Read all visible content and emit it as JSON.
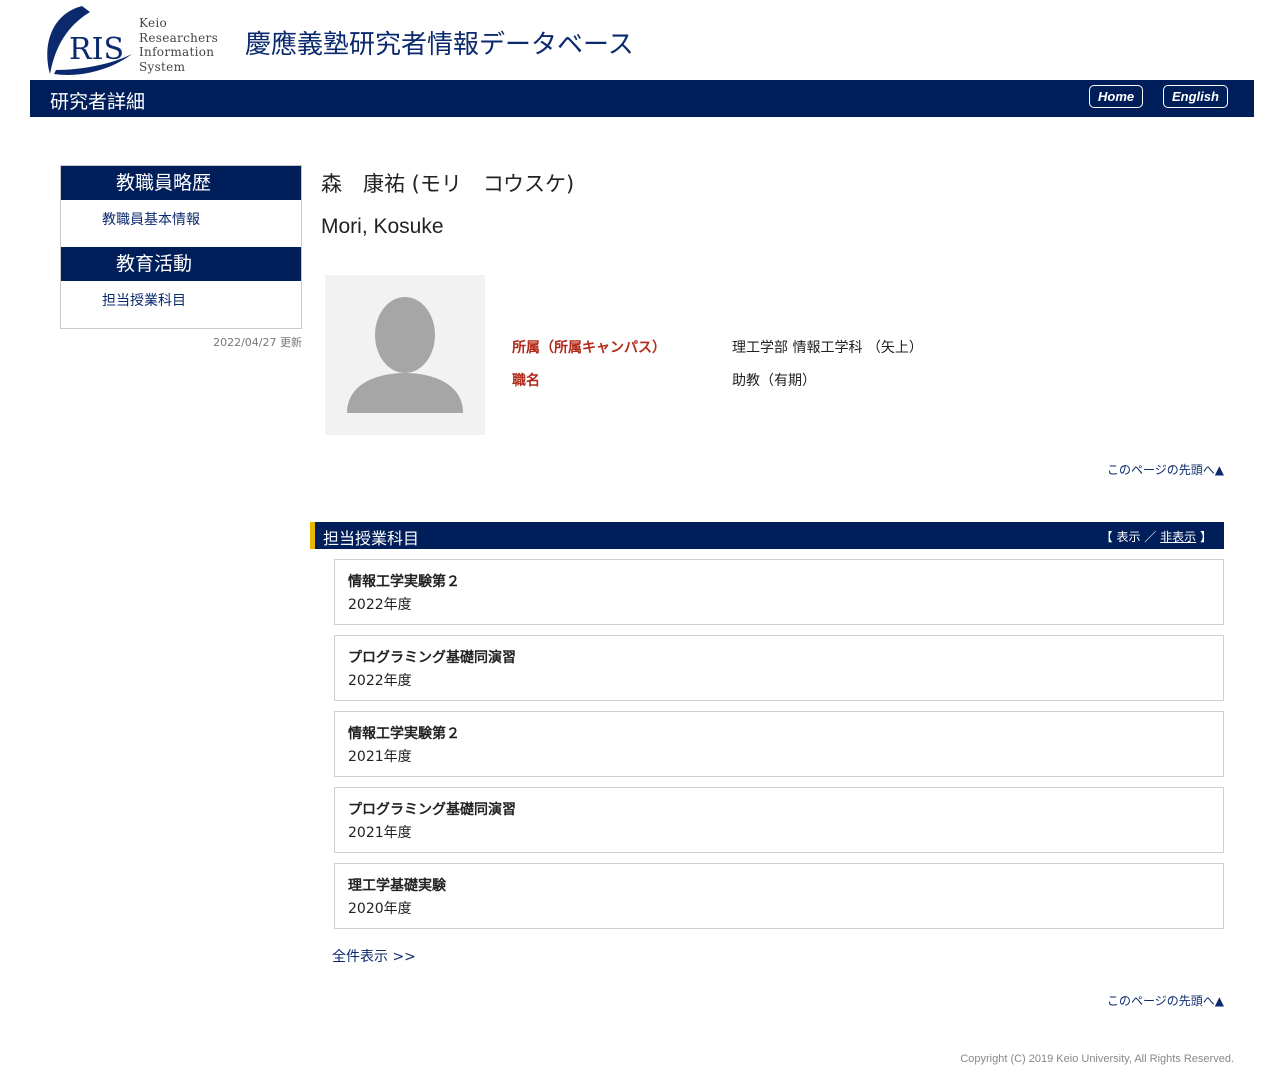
{
  "header": {
    "logo_text": "RIS",
    "logo_words": [
      "Keio",
      "Researchers",
      "Information",
      "System"
    ],
    "site_title": "慶應義塾研究者情報データベース"
  },
  "nav": {
    "page_title": "研究者詳細",
    "home_label": "Home",
    "english_label": "English"
  },
  "sidebar": {
    "sections": [
      {
        "heading": "教職員略歴",
        "link": "教職員基本情報"
      },
      {
        "heading": "教育活動",
        "link": "担当授業科目"
      }
    ],
    "updated": "2022/04/27 更新"
  },
  "profile": {
    "name_ja": "森　康祐 (モリ　コウスケ)",
    "name_en": "Mori, Kosuke",
    "fields": [
      {
        "label": "所属（所属キャンパス）",
        "value": "理工学部 情報工学科 （矢上）"
      },
      {
        "label": "職名",
        "value": "助教（有期）"
      }
    ]
  },
  "to_top_label": "このページの先頭へ▲",
  "courses_section": {
    "title": "担当授業科目",
    "toggle_open": "【",
    "show_label": "表示",
    "separator": "／",
    "hide_label": "非表示",
    "toggle_close": "】",
    "items": [
      {
        "title": "情報工学実験第２",
        "year": "2022年度"
      },
      {
        "title": "プログラミング基礎同演習",
        "year": "2022年度"
      },
      {
        "title": "情報工学実験第２",
        "year": "2021年度"
      },
      {
        "title": "プログラミング基礎同演習",
        "year": "2021年度"
      },
      {
        "title": "理工学基礎実験",
        "year": "2020年度"
      }
    ],
    "all_label": "全件表示 >>"
  },
  "footer": {
    "copyright": "Copyright (C) 2019 Keio University, All Rights Reserved."
  },
  "colors": {
    "navy": "#001e5a",
    "accent_yellow": "#e8b800",
    "label_red": "#b22a1a"
  }
}
